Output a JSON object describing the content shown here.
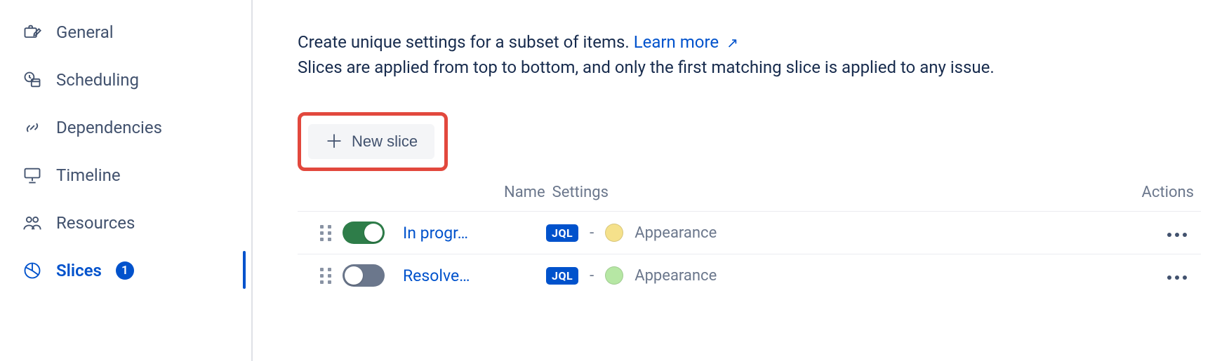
{
  "sidebar": {
    "items": [
      {
        "id": "general",
        "label": "General",
        "icon": "briefcase-edit-icon",
        "selected": false
      },
      {
        "id": "scheduling",
        "label": "Scheduling",
        "icon": "clock-calendar-icon",
        "selected": false
      },
      {
        "id": "dependencies",
        "label": "Dependencies",
        "icon": "link-icon",
        "selected": false
      },
      {
        "id": "timeline",
        "label": "Timeline",
        "icon": "presentation-icon",
        "selected": false
      },
      {
        "id": "resources",
        "label": "Resources",
        "icon": "people-icon",
        "selected": false
      },
      {
        "id": "slices",
        "label": "Slices",
        "icon": "pie-icon",
        "selected": true,
        "badge": "1"
      }
    ]
  },
  "main": {
    "intro_prefix": "Create unique settings for a subset of items. ",
    "learn_more": "Learn more",
    "intro_suffix": "Slices are applied from top to bottom, and only the first matching slice is applied to any issue.",
    "new_slice_label": "New slice",
    "columns": {
      "name": "Name",
      "settings": "Settings",
      "actions": "Actions"
    },
    "rows": [
      {
        "enabled": true,
        "name": "In progr…",
        "tag": "JQL",
        "dash": "-",
        "dot_color": "#F5E18B",
        "setting_label": "Appearance"
      },
      {
        "enabled": false,
        "name": "Resolve…",
        "tag": "JQL",
        "dash": "-",
        "dot_color": "#B6E7A4",
        "setting_label": "Appearance"
      }
    ]
  }
}
